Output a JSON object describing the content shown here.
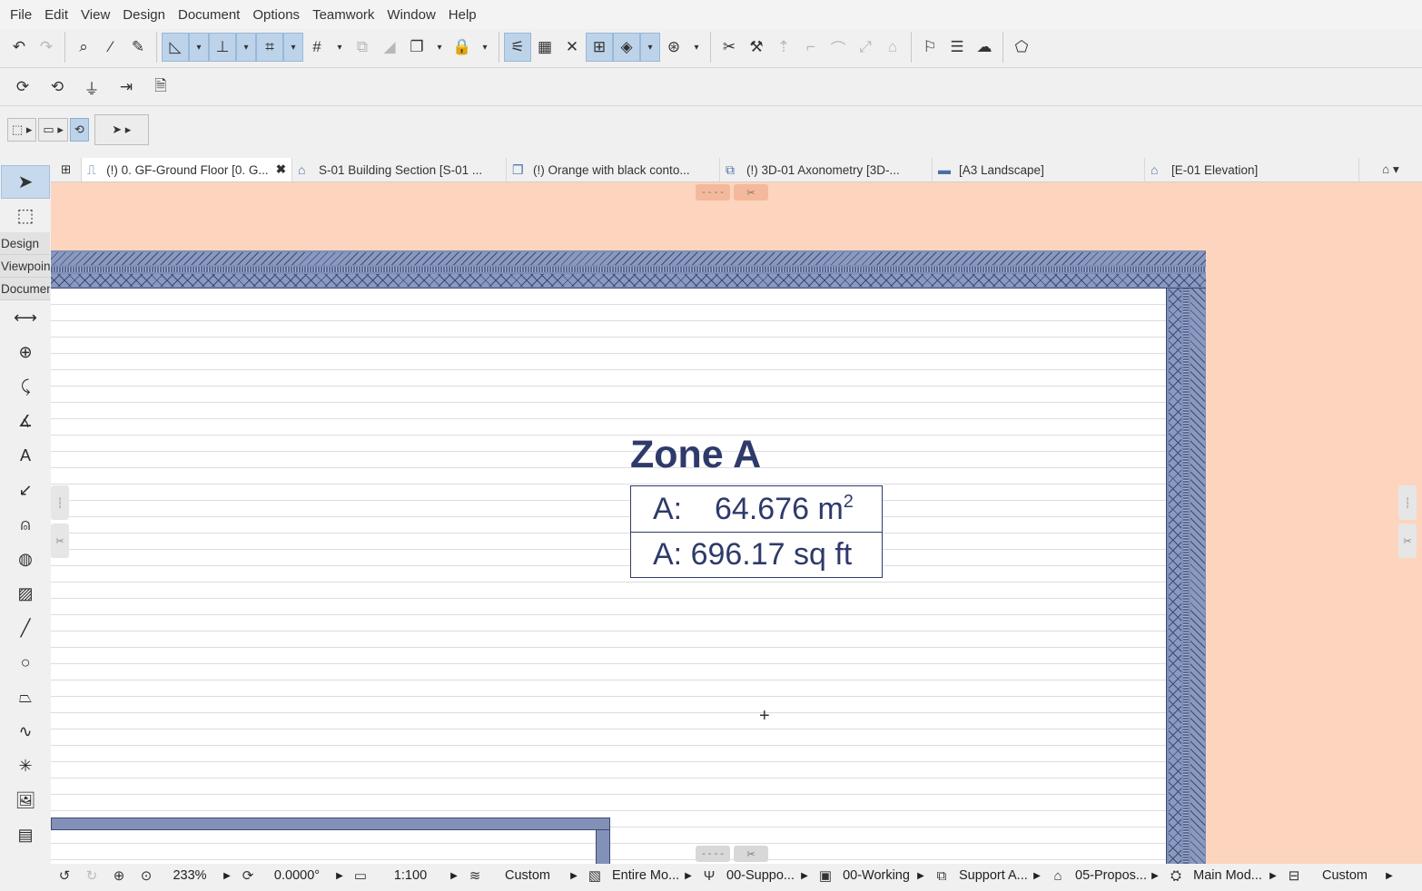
{
  "menu": [
    "File",
    "Edit",
    "View",
    "Design",
    "Document",
    "Options",
    "Teamwork",
    "Window",
    "Help"
  ],
  "palette_labels": [
    "Design",
    "Viewpoint",
    "Document"
  ],
  "tabs": [
    {
      "label": "(!) 0. GF-Ground Floor [0. G...",
      "icon": "floor-plan-icon",
      "close": "✖"
    },
    {
      "label": "S-01 Building Section [S-01 ...",
      "icon": "section-icon"
    },
    {
      "label": "(!) Orange with black conto...",
      "icon": "3d-box-icon"
    },
    {
      "label": "(!) 3D-01 Axonometry [3D-...",
      "icon": "axonometry-icon"
    },
    {
      "label": "[A3 Landscape]",
      "icon": "layout-icon"
    },
    {
      "label": "[E-01 Elevation]",
      "icon": "elevation-icon"
    }
  ],
  "zone": {
    "name": "Zone A",
    "area_label": "A:",
    "area_metric": "64.676 m",
    "area_metric_sup": "2",
    "area_imperial": "A: 696.17 sq ft"
  },
  "status": {
    "zoom": "233%",
    "angle": "0.0000°",
    "scale": "1:100",
    "layer_combo": "Custom",
    "model_view": "Entire Mo...",
    "pen_set": "00-Suppo...",
    "graphic_override": "00-Working",
    "partial_structure": "Support A...",
    "renovation": "05-Propos...",
    "model_view_option": "Main Mod...",
    "dimension": "Custom"
  },
  "colors": {
    "canvas_bg": "#fdd4be",
    "wall_fill": "#7f8fb7",
    "zone_text": "#2e3a6a",
    "selected_tool": "#bcd3ea"
  }
}
